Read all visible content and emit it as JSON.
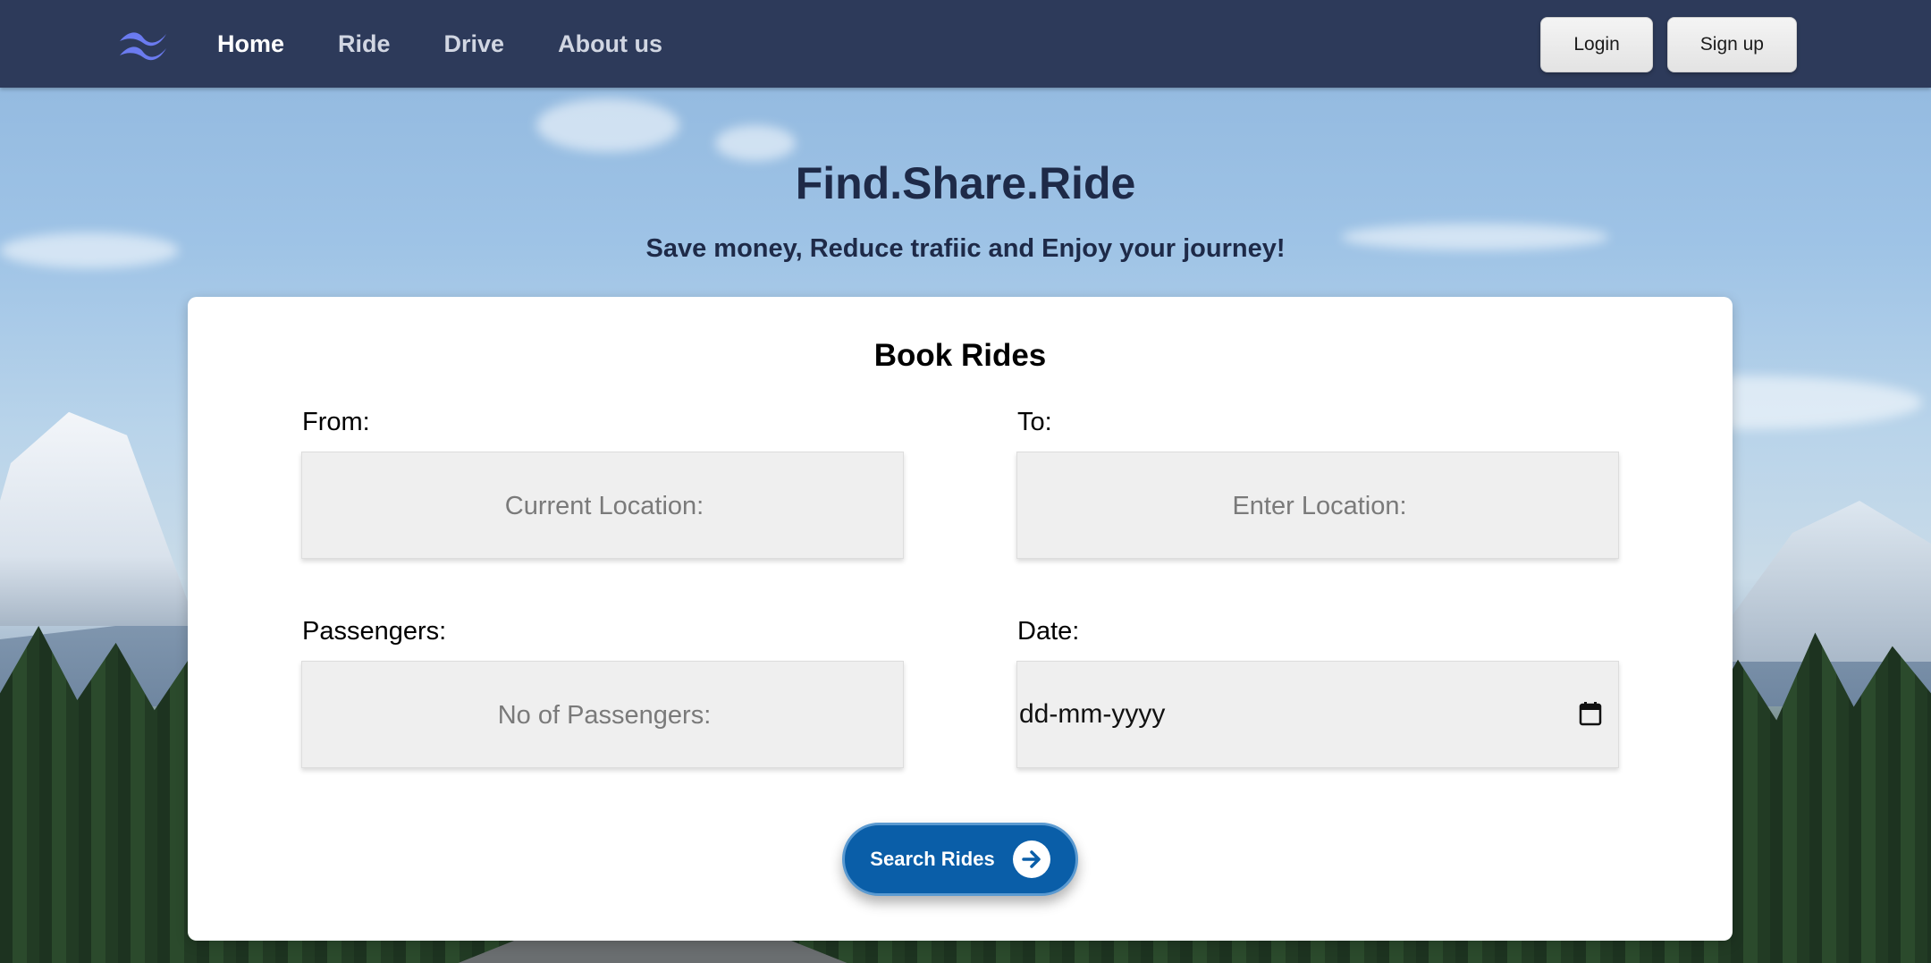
{
  "nav": {
    "links": [
      {
        "label": "Home",
        "active": true
      },
      {
        "label": "Ride",
        "active": false
      },
      {
        "label": "Drive",
        "active": false
      },
      {
        "label": "About us",
        "active": false
      }
    ],
    "login_label": "Login",
    "signup_label": "Sign up"
  },
  "hero": {
    "title": "Find.Share.Ride",
    "subtitle": "Save money, Reduce trafiic and Enjoy your journey!"
  },
  "booking": {
    "title": "Book Rides",
    "from": {
      "label": "From:",
      "placeholder": "Current Location:"
    },
    "to": {
      "label": "To:",
      "placeholder": "Enter Location:"
    },
    "passengers": {
      "label": "Passengers:",
      "placeholder": "No of Passengers:"
    },
    "date": {
      "label": "Date:",
      "value": "dd-mm-yyyy"
    },
    "search_label": "Search Rides"
  },
  "icons": {
    "logo": "wave-logo-icon",
    "calendar": "calendar-icon",
    "arrow": "arrow-right-circle-icon"
  },
  "colors": {
    "header_bg": "#2d3a5a",
    "logo": "#6b7bf0",
    "heading_text": "#1e2a48",
    "search_button": "#0a5ea8"
  }
}
